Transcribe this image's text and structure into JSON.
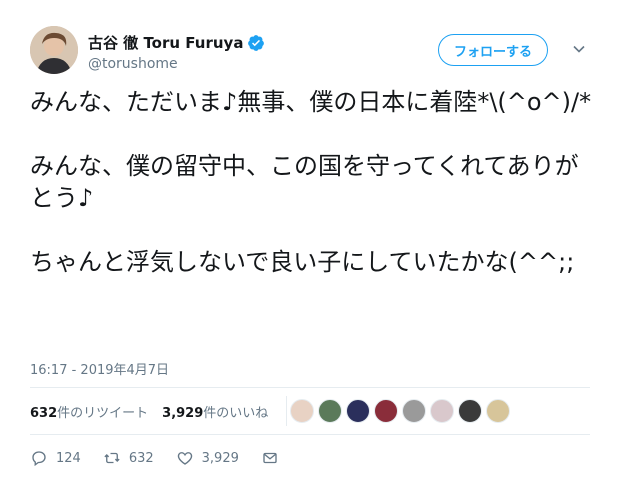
{
  "header": {
    "display_name": "古谷 徹 Toru Furuya",
    "handle": "@torushome",
    "follow_label": "フォローする"
  },
  "tweet": {
    "text": "みんな、ただいま♪無事、僕の日本に着陸*\\(^o^)/*\n\nみんな、僕の留守中、この国を守ってくれてありがとう♪\n\nちゃんと浮気しないで良い子にしていたかな(^^;;",
    "timestamp": "16:17 - 2019年4月7日"
  },
  "stats": {
    "retweets_count": "632",
    "retweets_label": "件のリツイート",
    "likes_count": "3,929",
    "likes_label": "件のいいね"
  },
  "likers": [
    {
      "icon": "avatar-1",
      "color": "#e8d2c4"
    },
    {
      "icon": "avatar-2",
      "color": "#5b7a5a"
    },
    {
      "icon": "avatar-3",
      "color": "#2b2f5c"
    },
    {
      "icon": "avatar-4",
      "color": "#8a2d3a"
    },
    {
      "icon": "avatar-5",
      "color": "#9a9a9a"
    },
    {
      "icon": "avatar-6",
      "color": "#d9c8cc"
    },
    {
      "icon": "avatar-7",
      "color": "#3a3a3a"
    },
    {
      "icon": "avatar-8",
      "color": "#d7c59a"
    }
  ],
  "actions": {
    "reply_count": "124",
    "retweet_count": "632",
    "like_count": "3,929"
  },
  "colors": {
    "accent": "#1da1f2",
    "text": "#14171a",
    "muted": "#657786",
    "divider": "#e6ecf0"
  }
}
